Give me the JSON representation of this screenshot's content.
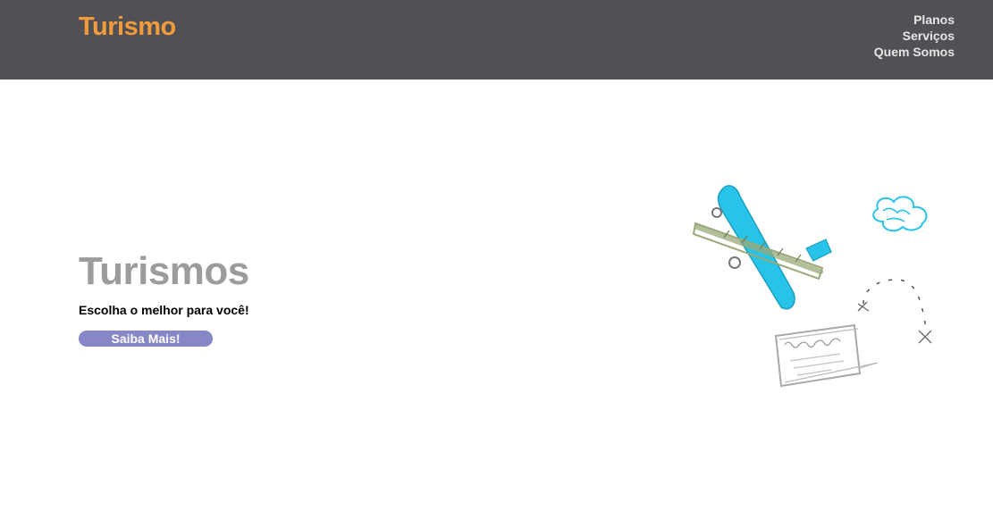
{
  "header": {
    "logo": "Turismo",
    "nav": [
      {
        "label": "Planos"
      },
      {
        "label": "Serviços"
      },
      {
        "label": "Quem Somos"
      }
    ]
  },
  "hero": {
    "title": "Turismos",
    "subtitle": "Escolha o melhor para você!",
    "cta_label": "Saiba Mais!",
    "illustration_icons": [
      "airplane-icon",
      "cloud-icon",
      "ticket-icon",
      "dashed-route-icon"
    ]
  },
  "colors": {
    "header_bg": "#505055",
    "logo": "#f19b3c",
    "nav_text": "#e6e6e6",
    "hero_title": "#9c9c9c",
    "button_bg": "#8787c8",
    "button_text": "#ffffff",
    "plane_wing": "#27c3e8",
    "plane_body": "#9aa97a",
    "sketch_gray": "#a9a9a9"
  }
}
